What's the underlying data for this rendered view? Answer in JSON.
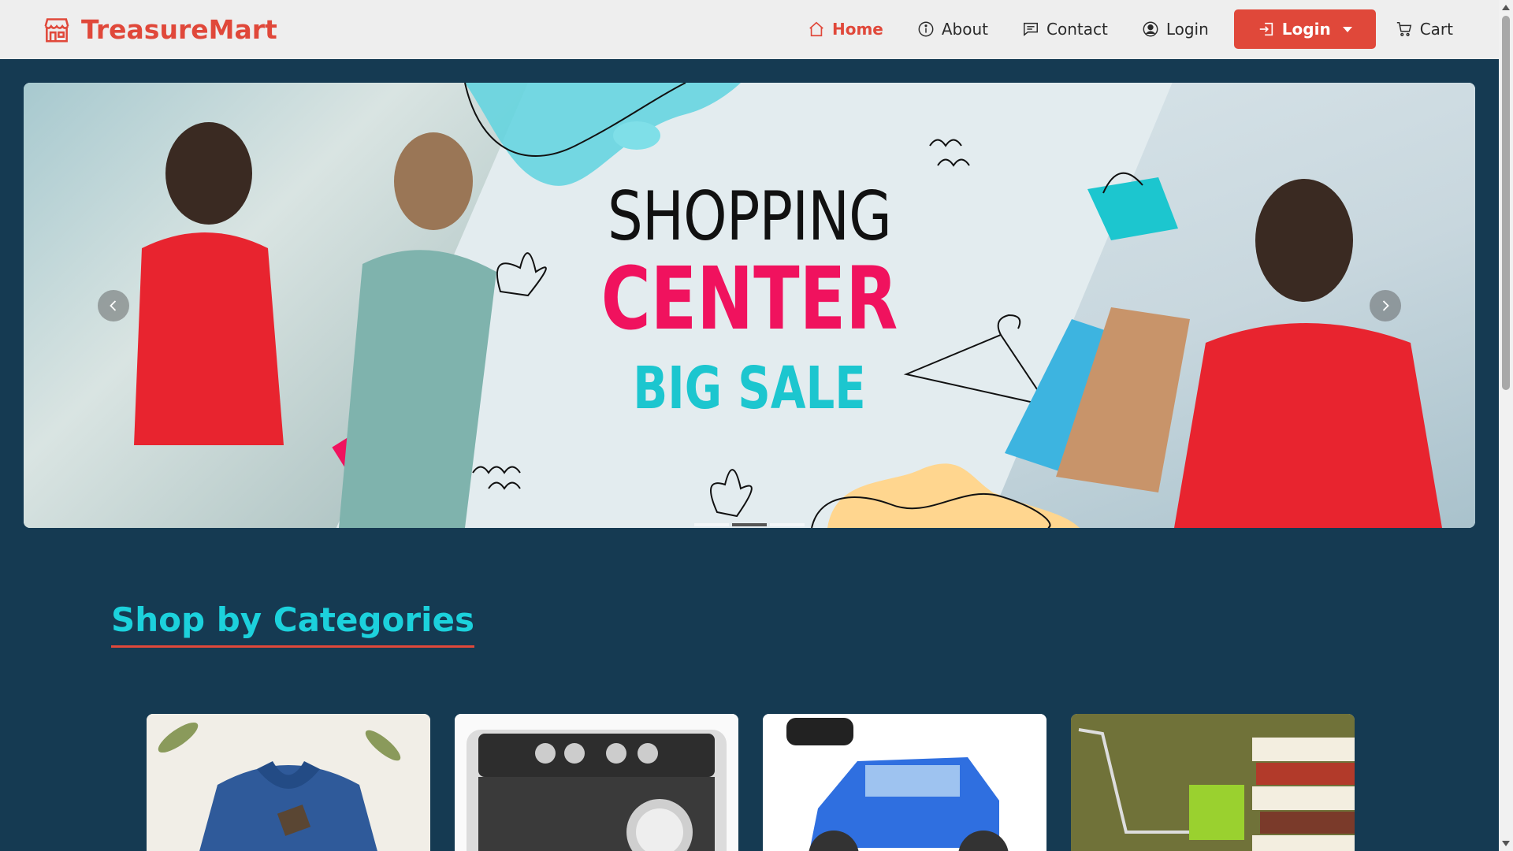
{
  "brand": {
    "name": "TreasureMart",
    "icon": "store-icon"
  },
  "nav": {
    "items": [
      {
        "label": "Home",
        "icon": "home-icon",
        "active": true
      },
      {
        "label": "About",
        "icon": "info-circle-icon",
        "active": false
      },
      {
        "label": "Contact",
        "icon": "chat-icon",
        "active": false
      },
      {
        "label": "Login",
        "icon": "user-circle-icon",
        "active": false
      }
    ],
    "login_dropdown": {
      "label": "Login",
      "icon": "sign-in-icon"
    },
    "cart": {
      "label": "Cart",
      "icon": "cart-icon"
    }
  },
  "carousel": {
    "slide": {
      "line1": "SHOPPING",
      "line2": "CENTER",
      "line3": "BIG SALE"
    },
    "slide_count": 3,
    "active_index": 1
  },
  "categories": {
    "title": "Shop by Categories",
    "items": [
      {
        "name": "clothing-category",
        "image": "shirt"
      },
      {
        "name": "appliances-category",
        "image": "washing-machine"
      },
      {
        "name": "toys-category",
        "image": "rc-car"
      },
      {
        "name": "books-category",
        "image": "books-cart"
      }
    ]
  },
  "colors": {
    "accent": "#e0483a",
    "background": "#153a52",
    "navbar": "#eeeeee",
    "heading": "#1cd1dc",
    "hero_pink": "#f0125e",
    "hero_cyan": "#1cc6cf"
  }
}
